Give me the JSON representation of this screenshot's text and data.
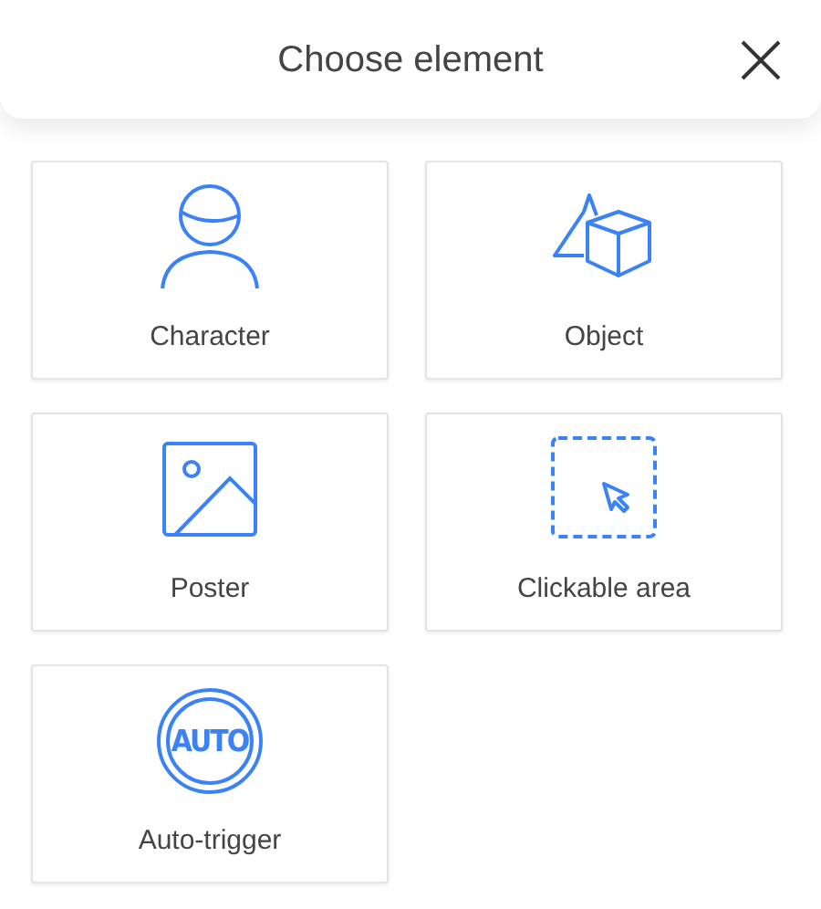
{
  "header": {
    "title": "Choose element"
  },
  "elements": [
    {
      "kind": "character",
      "label": "Character"
    },
    {
      "kind": "object",
      "label": "Object"
    },
    {
      "kind": "poster",
      "label": "Poster"
    },
    {
      "kind": "clickable",
      "label": "Clickable area"
    },
    {
      "kind": "auto",
      "label": "Auto-trigger",
      "icon_text": "AUTO"
    }
  ]
}
